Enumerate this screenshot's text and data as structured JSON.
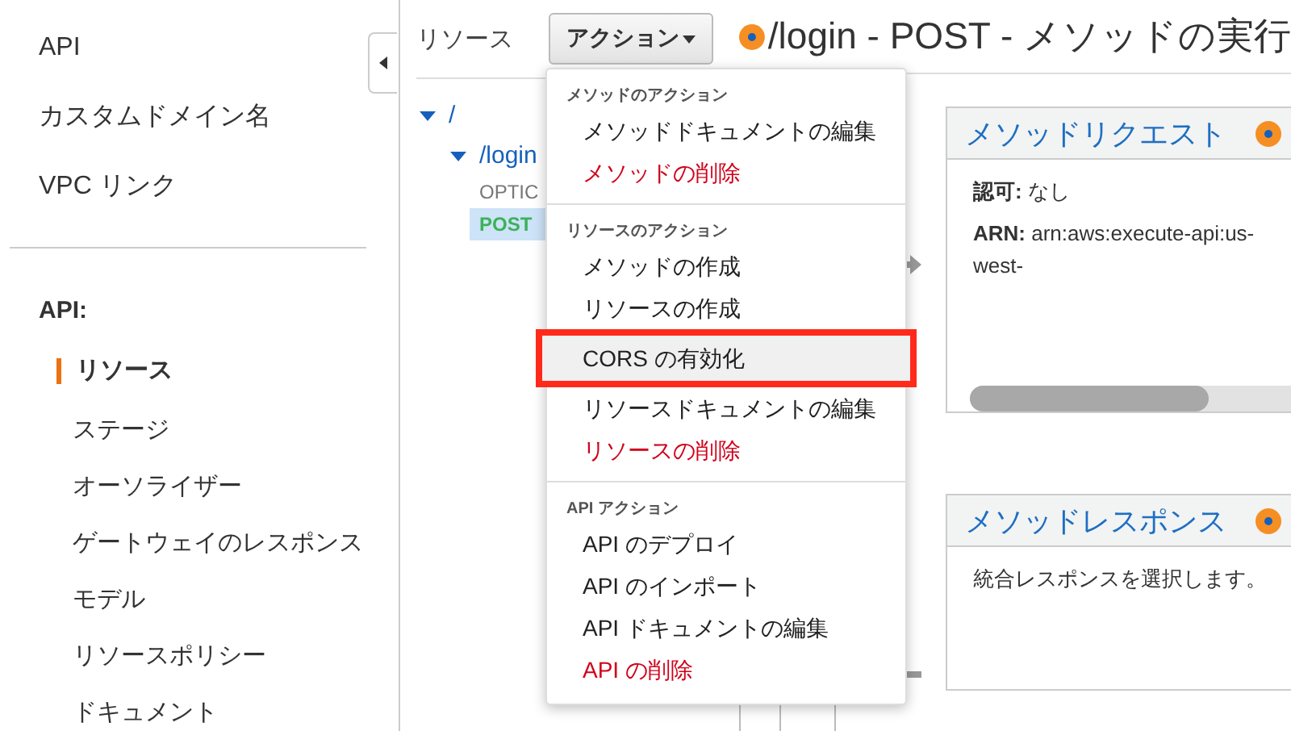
{
  "sidebar": {
    "top_items": [
      {
        "label": "API"
      },
      {
        "label": "カスタムドメイン名"
      },
      {
        "label": "VPC リンク"
      }
    ],
    "section_label": "API:",
    "items": [
      {
        "label": "リソース",
        "selected": true
      },
      {
        "label": "ステージ",
        "selected": false
      },
      {
        "label": "オーソライザー",
        "selected": false
      },
      {
        "label": "ゲートウェイのレスポンス",
        "selected": false
      },
      {
        "label": "モデル",
        "selected": false
      },
      {
        "label": "リソースポリシー",
        "selected": false
      },
      {
        "label": "ドキュメント",
        "selected": false
      }
    ]
  },
  "resources": {
    "title": "リソース",
    "actions_button": "アクション",
    "tree": [
      {
        "label": "/",
        "expanded": true,
        "children": [
          {
            "label": "/login",
            "expanded": true,
            "children": [
              {
                "label": "OPTIC",
                "selected": false
              },
              {
                "label": "POST",
                "selected": true
              }
            ]
          }
        ]
      }
    ]
  },
  "menu": {
    "sections": [
      {
        "title": "メソッドのアクション",
        "items": [
          {
            "label": "メソッドドキュメントの編集",
            "kind": "normal",
            "selected": false
          },
          {
            "label": "メソッドの削除",
            "kind": "danger",
            "selected": false
          }
        ]
      },
      {
        "title": "リソースのアクション",
        "items": [
          {
            "label": "メソッドの作成",
            "kind": "normal",
            "selected": false
          },
          {
            "label": "リソースの作成",
            "kind": "normal",
            "selected": false
          },
          {
            "label": "CORS の有効化",
            "kind": "normal",
            "selected": true
          },
          {
            "label": "リソースドキュメントの編集",
            "kind": "normal",
            "selected": false
          },
          {
            "label": "リソースの削除",
            "kind": "danger",
            "selected": false
          }
        ]
      },
      {
        "title": "API アクション",
        "items": [
          {
            "label": "API のデプロイ",
            "kind": "normal",
            "selected": false
          },
          {
            "label": "API のインポート",
            "kind": "normal",
            "selected": false
          },
          {
            "label": "API ドキュメントの編集",
            "kind": "normal",
            "selected": false
          },
          {
            "label": "API の削除",
            "kind": "danger",
            "selected": false
          }
        ]
      }
    ]
  },
  "main": {
    "title": "/login - POST - メソッドの実行",
    "cards": [
      {
        "title": "メソッドリクエスト",
        "lines": [
          "**認可:** なし",
          "**ARN:** arn:aws:execute-api:us-west-"
        ],
        "scrollbar": true
      },
      {
        "title": "メソッドレスポンス",
        "lines": [
          "統合レスポンスを選択します。"
        ],
        "scrollbar": false
      }
    ]
  }
}
